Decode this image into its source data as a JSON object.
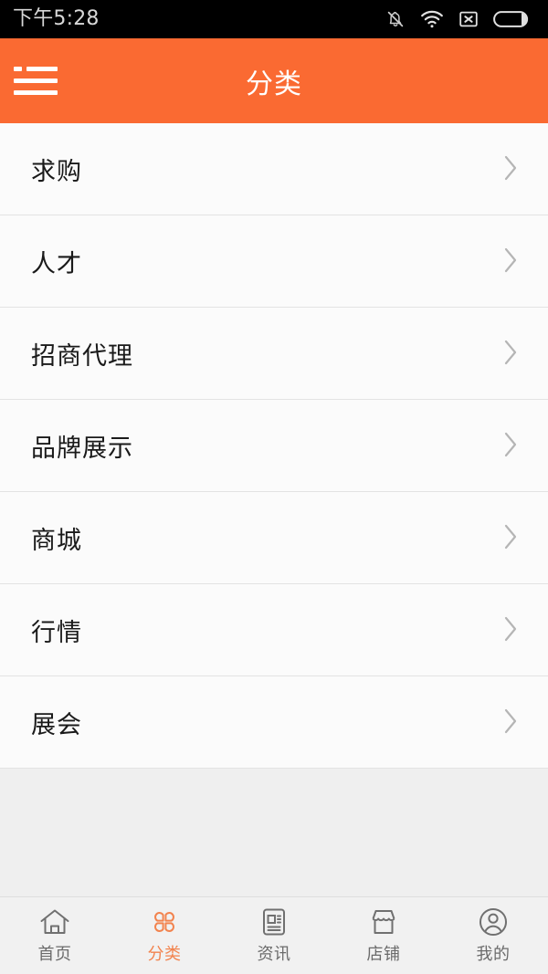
{
  "colors": {
    "header_orange": "#fa6a32",
    "accent_orange": "#f2834e",
    "list_bg": "#fbfbfb",
    "gap_gray": "#efefef",
    "nav_bg": "#f1f1f1",
    "nav_label": "#6b6b6b",
    "status_bg": "#000000",
    "status_text": "#d8d8d8",
    "divider": "#e3e3e3",
    "chevron": "#b5b5b5",
    "text_primary": "#1a1a1a"
  },
  "status_bar": {
    "time": "下午5:28",
    "icons": [
      {
        "name": "bell-muted-icon"
      },
      {
        "name": "wifi-icon"
      },
      {
        "name": "no-signal-x-icon"
      },
      {
        "name": "battery-icon"
      }
    ]
  },
  "header": {
    "menu_icon": "hamburger-menu-icon",
    "title": "分类"
  },
  "categories": [
    {
      "label": "求购",
      "chevron": "chevron-right-icon"
    },
    {
      "label": "人才",
      "chevron": "chevron-right-icon"
    },
    {
      "label": "招商代理",
      "chevron": "chevron-right-icon"
    },
    {
      "label": "品牌展示",
      "chevron": "chevron-right-icon"
    },
    {
      "label": "商城",
      "chevron": "chevron-right-icon"
    },
    {
      "label": "行情",
      "chevron": "chevron-right-icon"
    },
    {
      "label": "展会",
      "chevron": "chevron-right-icon"
    }
  ],
  "bottom_nav": {
    "active_index": 1,
    "items": [
      {
        "label": "首页",
        "icon": "home-icon"
      },
      {
        "label": "分类",
        "icon": "clover-grid-icon"
      },
      {
        "label": "资讯",
        "icon": "news-document-icon"
      },
      {
        "label": "店铺",
        "icon": "storefront-icon"
      },
      {
        "label": "我的",
        "icon": "user-profile-icon"
      }
    ]
  }
}
